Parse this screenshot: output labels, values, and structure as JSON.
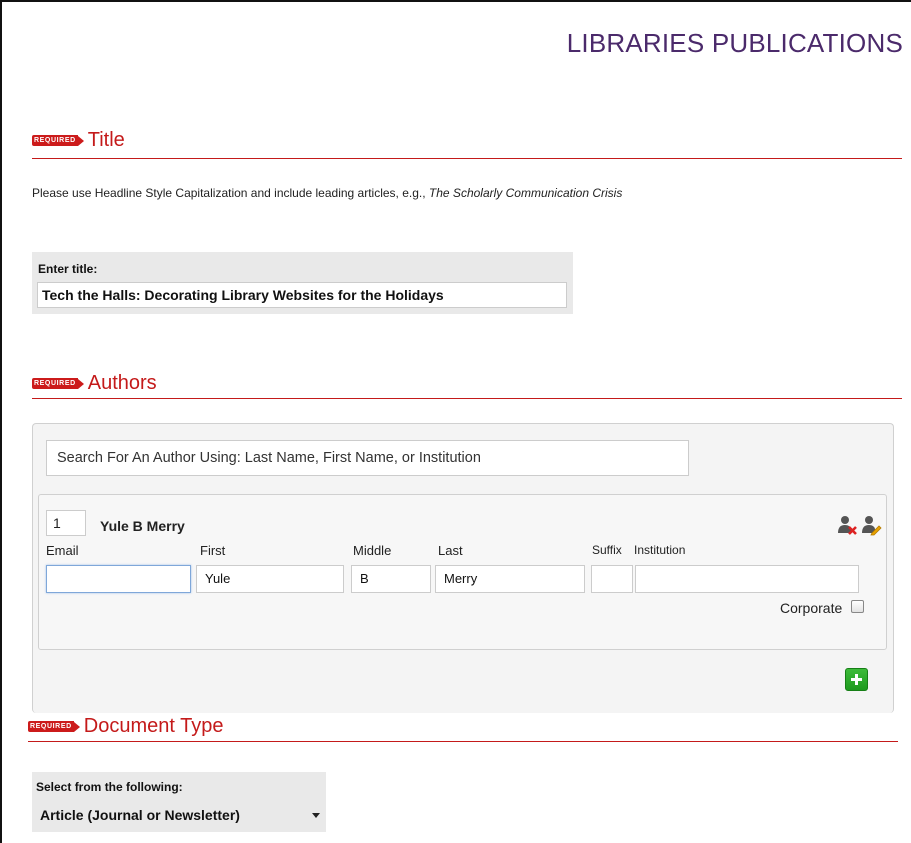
{
  "header": {
    "title": "LIBRARIES PUBLICATIONS"
  },
  "required_badge": "REQUIRED",
  "title_section": {
    "label": "Title",
    "help_text_prefix": "Please use Headline Style Capitalization and include leading articles, e.g.,",
    "help_text_example": "The Scholarly Communication Crisis",
    "input_label": "Enter title:",
    "input_value": "Tech the Halls: Decorating Library Websites for the Holidays"
  },
  "authors_section": {
    "label": "Authors",
    "search_placeholder": "Search For An Author Using: Last Name, First Name, or Institution",
    "author": {
      "order": "1",
      "display_name": "Yule B Merry",
      "labels": {
        "email": "Email",
        "first": "First",
        "middle": "Middle",
        "last": "Last",
        "suffix": "Suffix",
        "institution": "Institution"
      },
      "values": {
        "email": "",
        "first": "Yule",
        "middle": "B",
        "last": "Merry",
        "suffix": "",
        "institution": ""
      },
      "corporate_label": "Corporate",
      "corporate_checked": false
    },
    "icons": {
      "remove": "remove-author-icon",
      "edit": "edit-author-icon",
      "add": "add-author-icon"
    }
  },
  "doctype_section": {
    "label": "Document Type",
    "select_label": "Select from the following:",
    "selected_value": "Article (Journal or Newsletter)"
  },
  "colors": {
    "accent_red": "#c41a1a",
    "title_purple": "#4b2a6b",
    "add_green": "#2aa52a"
  }
}
